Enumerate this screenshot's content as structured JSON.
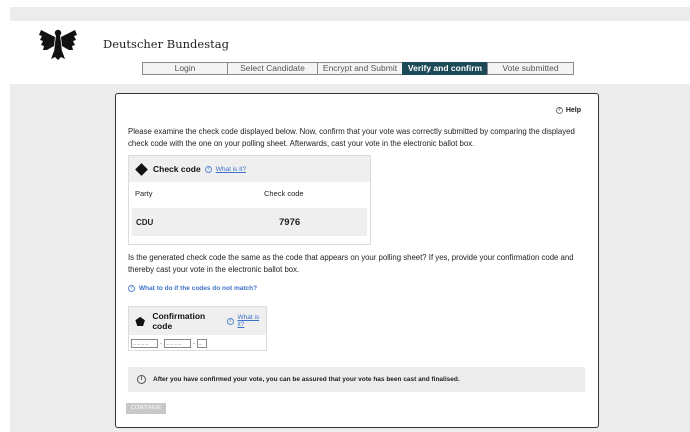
{
  "header": {
    "site_title": "Deutscher Bundestag",
    "logo_icon": "federal-eagle-icon"
  },
  "steps": [
    {
      "label": "Login",
      "active": false
    },
    {
      "label": "Select Candidate",
      "active": false
    },
    {
      "label": "Encrypt and Submit",
      "active": false
    },
    {
      "label": "Verify and confirm",
      "active": true
    },
    {
      "label": "Vote submitted",
      "active": false
    }
  ],
  "help_label": "Help",
  "intro_text": "Please examine the check code displayed below. Now, confirm that your vote was correctly submitted by comparing the displayed check code with the one on your polling sheet. Afterwards, cast your vote in the electronic ballot box.",
  "check_code_card": {
    "title": "Check code",
    "what_is_it": "What is it?",
    "col_party": "Party",
    "col_check_code": "Check code",
    "party": "CDU",
    "code": "7976"
  },
  "question_text": "Is the generated check code the same as the code that appears on your polling sheet? If yes, provide your confirmation code and thereby cast your vote in the electronic ballot box.",
  "mismatch_link": "What to do if the codes do not match?",
  "confirmation_card": {
    "title": "Confirmation code",
    "what_is_it": "What is it?",
    "field1_placeholder": "_ _ _ _",
    "field2_placeholder": "_ _ _ _",
    "field3_placeholder": "_",
    "separator": "-"
  },
  "notice_text": "After you have confirmed your vote, you can be assured that your vote has been cast and finalised.",
  "continue_label": "CONTINUE",
  "colors": {
    "active_step": "#1c4a57",
    "link": "#3d72c8",
    "background_gray": "#ececec"
  }
}
